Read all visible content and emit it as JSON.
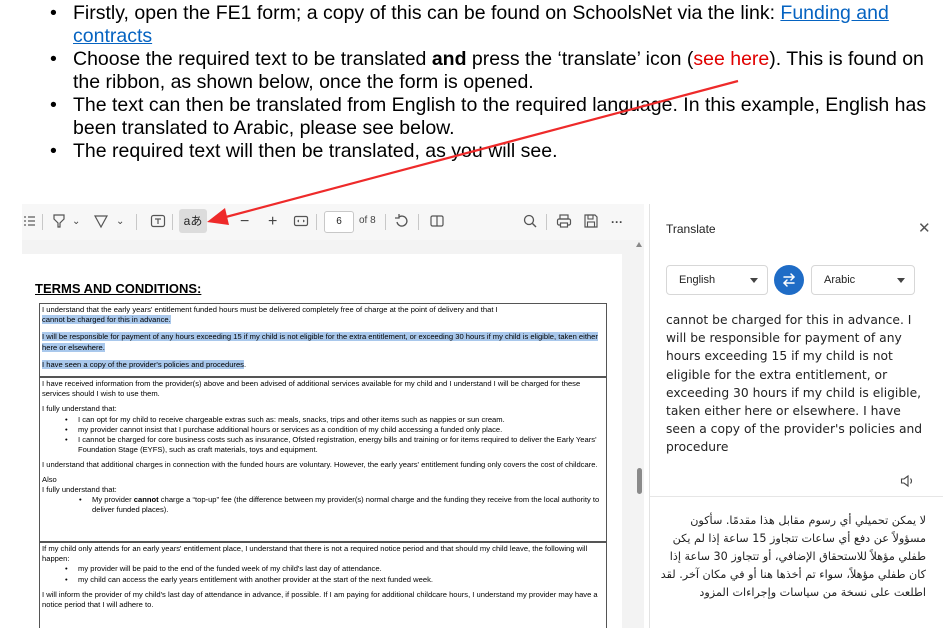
{
  "instructions": {
    "item1": {
      "text": "Firstly, open the FE1 form; a copy of this can be found on SchoolsNet via the link: ",
      "link": "Funding and contracts"
    },
    "item2": {
      "pre": "Choose the required text to be translated ",
      "bold": "and",
      "mid": " press the ‘translate’ icon (",
      "red": "see here",
      "post": ").  This is found on the ribbon, as shown below, once the form is opened."
    },
    "item3": {
      "text": "The text can then be translated from English to the required language.  In this example, English has been translated to Arabic, please see below."
    },
    "item4": {
      "text": "The required text will then be translated, as you will see."
    }
  },
  "toolbar": {
    "translate_label": "aあ",
    "zoom_out": "−",
    "zoom_in": "+",
    "page_number": "6",
    "page_total": "of 8",
    "more": "···"
  },
  "document": {
    "title": "TERMS AND CONDITIONS:",
    "box1_line1": "I understand that the early years' entitlement funded hours must be delivered completely free of charge at the point of delivery and that I",
    "box1_line2": "cannot be charged for this in advance.",
    "box1_para2": "I will be responsible for payment of any hours exceeding 15 if my child is not eligible for the extra entitlement, or exceeding 30 hours if my child is eligible, taken either here or elsewhere.",
    "box1_para3_hl": "I have seen a copy of the provider's policies and procedures",
    "box1_para3_end": ".",
    "box2_para1": "I have received information from the provider(s) above and been advised of additional services available for my child and I understand I will be charged for these services should I wish to use them.",
    "box2_para2": "I fully understand that:",
    "box2_bullets": [
      "I can opt for my child to receive chargeable extras such as: meals, snacks, trips and other items such as nappies or sun cream.",
      "my provider cannot insist that I purchase additional hours or services as a condition of my child accessing a funded only place.",
      "I cannot be charged for core business costs such as insurance, Ofsted registration, energy bills and training or for items required to deliver the Early Years' Foundation Stage (EYFS), such as craft materials, toys and equipment."
    ],
    "box2_para3": "I understand that additional charges in connection with the funded hours are voluntary.  However, the early years' entitlement funding only covers the cost of childcare.",
    "box2_also": "Also",
    "box2_para4": "I fully understand that:",
    "box2_bullet_pre": "My provider ",
    "box2_bullet_bold": "cannot",
    "box2_bullet_post": " charge a “top-up” fee (the difference between my provider(s) normal charge and the funding they receive from the local authority to deliver funded places).",
    "box3_para1": "If my child only attends for an early years' entitlement place, I understand that there is not a required notice period and that should my child leave, the following will happen:",
    "box3_bullets": [
      "my provider will be paid to the end of the funded week of my child's last day of attendance.",
      "my child can access the early years entitlement with another provider at the start of the next funded week."
    ],
    "box3_para2": "I will inform the provider of my child's last day of attendance in advance, if possible. If I am paying for additional childcare hours, I understand my provider may have a notice period that I will adhere to."
  },
  "translate_pane": {
    "title": "Translate",
    "source_language": "English",
    "target_language": "Arabic",
    "source_text": "cannot be charged for this in advance. I will be responsible for payment of any hours exceeding 15 if my child is not eligible for the extra entitlement, or exceeding 30 hours if my child is eligible, taken either here or elsewhere. I have seen a copy of the provider's policies and procedure",
    "translated_text": "لا يمكن تحميلي أي رسوم مقابل هذا مقدمًا. سأكون مسؤولاً عن دفع أي ساعات تتجاوز 15 ساعة إذا لم يكن طفلي مؤهلاً للاستحقاق الإضافي، أو تتجاوز 30 ساعة إذا كان طفلي مؤهلاً، سواء تم أخذها هنا أو في مكان آخر. لقد اطلعت على نسخة من سياسات وإجراءات المزود"
  },
  "colors": {
    "link": "#0563c1",
    "annotation_red": "#e00000",
    "highlight": "#a9c8ec",
    "swap_button": "#1f6cc6"
  }
}
